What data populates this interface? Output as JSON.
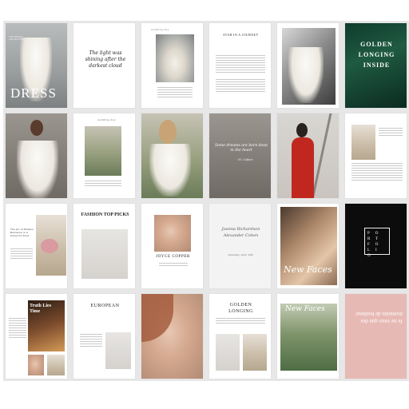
{
  "pages": {
    "p1": {
      "title": "DRESS",
      "kicker": "THE BRIDAL COLLECTION"
    },
    "p2": {
      "quote": "The light was shining after the darkest cloud"
    },
    "p3": {
      "header": "wedding day"
    },
    "p4": {
      "title": "STAR IN A JOURNEY"
    },
    "p6": {
      "title": "GOLDEN LONGING INSIDE"
    },
    "p8": {
      "header": "wedding day"
    },
    "p10": {
      "quote": "Some dreams are born deep in the heart",
      "signature": "- M. Cofano"
    },
    "p13": {
      "block": "The Art of Modern Romance is a Colourful Kind"
    },
    "p14": {
      "title": "FASHION TOP PICKS"
    },
    "p15": {
      "name": "JOYCE COPPER"
    },
    "p16": {
      "names": "Joanna Richardson Alexander Cohen",
      "sub": "Saturday, April 12th"
    },
    "p17": {
      "script": "New Faces"
    },
    "p18": {
      "title": "PORTFOLIO"
    },
    "p19": {
      "title": "Truth Lies Time"
    },
    "p20": {
      "title": "EUROPEAN"
    },
    "p22": {
      "title": "GOLDEN LONGING"
    },
    "p23": {
      "script": "New Faces"
    },
    "p24": {
      "quote": "Je ne veux que des moments de bonheur"
    }
  }
}
